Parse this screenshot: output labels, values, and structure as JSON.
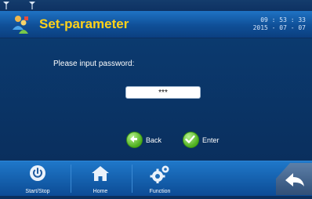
{
  "header": {
    "title": "Set-parameter",
    "time": "09 : 53 : 33",
    "date": "2015 - 07 - 07"
  },
  "main": {
    "prompt": "Please input password:",
    "password_value": "***",
    "back_label": "Back",
    "enter_label": "Enter"
  },
  "nav": {
    "start_stop": "Start/Stop",
    "home": "Home",
    "function": "Function"
  },
  "colors": {
    "title": "#ffd21a",
    "background": "#0a2f5e",
    "header": "#1f73c4",
    "accent_green": "#4caf1e"
  },
  "icons": [
    "signal-icon",
    "settings-people-icon",
    "power-icon",
    "home-icon",
    "gears-icon",
    "return-arrow-icon",
    "back-arrow-icon",
    "check-icon"
  ]
}
